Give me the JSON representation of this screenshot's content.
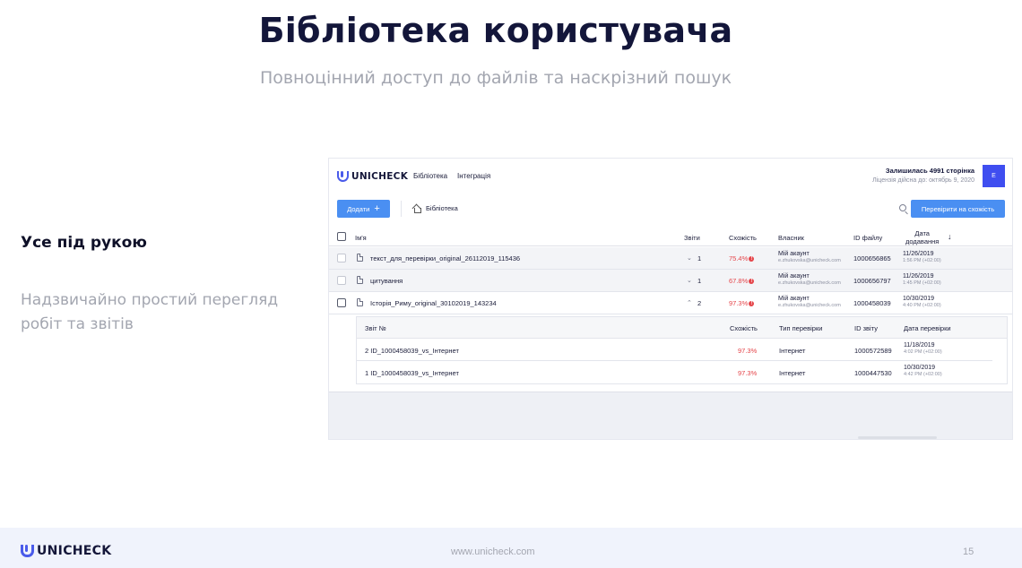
{
  "slide": {
    "title": "Бібліотека користувача",
    "subtitle": "Повноцінний доступ до файлів та наскрізний пошук",
    "feature_title": "Усе під рукою",
    "feature_desc": "Надзвичайно простий перегляд робіт та звітів"
  },
  "app": {
    "logo": "UNICHECK",
    "nav": [
      "Бібліотека",
      "Інтеграція"
    ],
    "pages_left": "Залишилась 4991 сторінка",
    "license": "Ліцензія дійсна до: октябрь 9, 2020",
    "avatar": "E",
    "add_label": "Додати",
    "add_icon": "+",
    "breadcrumb": "Бібліотека",
    "check_label": "Перевірити на схожість",
    "columns": {
      "name": "Ім'я",
      "reports": "Звіти",
      "similarity": "Схожість",
      "owner": "Власник",
      "file_id": "ID файлу",
      "date_line1": "Дата",
      "date_line2": "додавання",
      "sort_icon": "↓"
    },
    "rows": [
      {
        "name": "текст_для_перевірки_original_26112019_115436",
        "chev": "⌄",
        "reports": "1",
        "similarity": "75.4%",
        "owner": "Мій акаунт",
        "email": "e.zhukovska@unicheck.com",
        "file_id": "1000656865",
        "date": "11/26/2019",
        "time": "1:56 PM (+02:00)"
      },
      {
        "name": "цитування",
        "chev": "⌄",
        "reports": "1",
        "similarity": "67.8%",
        "owner": "Мій акаунт",
        "email": "e.zhukovska@unicheck.com",
        "file_id": "1000656797",
        "date": "11/26/2019",
        "time": "1:45 PM (+02:00)"
      },
      {
        "name": "Історія_Риму_original_30102019_143234",
        "chev": "⌃",
        "reports": "2",
        "similarity": "97.3%",
        "owner": "Мій акаунт",
        "email": "e.zhukovska@unicheck.com",
        "file_id": "1000458039",
        "date": "10/30/2019",
        "time": "4:40 PM (+02:00)"
      }
    ],
    "warn_icon": "!",
    "sub_columns": {
      "report": "Звіт №",
      "similarity": "Схожість",
      "type": "Тип перевірки",
      "report_id": "ID звіту",
      "date": "Дата перевірки"
    },
    "sub_rows": [
      {
        "report": "2 ID_1000458039_vs_Інтернет",
        "similarity": "97.3%",
        "type": "Інтернет",
        "report_id": "1000572589",
        "date": "11/18/2019",
        "time": "4:02 PM (+02:00)"
      },
      {
        "report": "1 ID_1000458039_vs_Інтернет",
        "similarity": "97.3%",
        "type": "Інтернет",
        "report_id": "1000447530",
        "date": "10/30/2019",
        "time": "4:42 PM (+02:00)"
      }
    ]
  },
  "footer": {
    "logo": "UNICHECK",
    "url": "www.unicheck.com",
    "page": "15"
  },
  "colors": {
    "brand": "#4a5bea",
    "button": "#4a8ff2",
    "danger": "#e5454a",
    "title": "#13163a",
    "muted": "#a3a6b0"
  }
}
